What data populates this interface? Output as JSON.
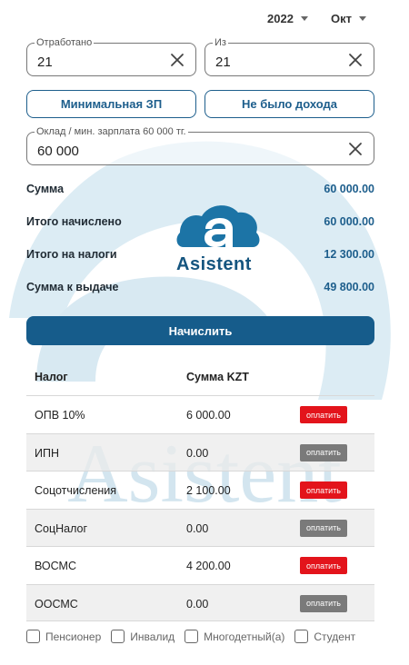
{
  "period": {
    "year": "2022",
    "month": "Окт"
  },
  "fields": {
    "worked": {
      "legend": "Отработано",
      "value": "21"
    },
    "of": {
      "legend": "Из",
      "value": "21"
    },
    "salary": {
      "legend": "Оклад / мин. зарплата 60 000 тг.",
      "value": "60 000"
    }
  },
  "buttons": {
    "min_wage": "Минимальная ЗП",
    "no_income": "Не было дохода",
    "calculate": "Начислить"
  },
  "summary": [
    {
      "label": "Сумма",
      "value": "60 000.00"
    },
    {
      "label": "Итого начислено",
      "value": "60 000.00"
    },
    {
      "label": "Итого на налоги",
      "value": "12 300.00"
    },
    {
      "label": "Сумма к выдаче",
      "value": "49 800.00"
    }
  ],
  "table": {
    "headers": [
      "Налог",
      "Сумма KZT"
    ],
    "pay_label": "оплатить",
    "rows": [
      {
        "tax": "ОПВ 10%",
        "amount": "6 000.00",
        "status": "active"
      },
      {
        "tax": "ИПН",
        "amount": "0.00",
        "status": "inactive"
      },
      {
        "tax": "Соцотчисления",
        "amount": "2 100.00",
        "status": "active"
      },
      {
        "tax": "СоцНалог",
        "amount": "0.00",
        "status": "inactive"
      },
      {
        "tax": "ВОСМС",
        "amount": "4 200.00",
        "status": "active"
      },
      {
        "tax": "ООСМС",
        "amount": "0.00",
        "status": "inactive"
      }
    ]
  },
  "checkboxes": [
    "Пенсионер",
    "Инвалид",
    "Многодетный(а)",
    "Студент"
  ],
  "logo": {
    "text": "Asistent"
  },
  "watermark": {
    "text": "Asistent"
  },
  "colors": {
    "primary": "#165c8b",
    "pay_active": "#e3141b",
    "pay_inactive": "#7a7a7a",
    "watermark": "#cfe3ee"
  }
}
